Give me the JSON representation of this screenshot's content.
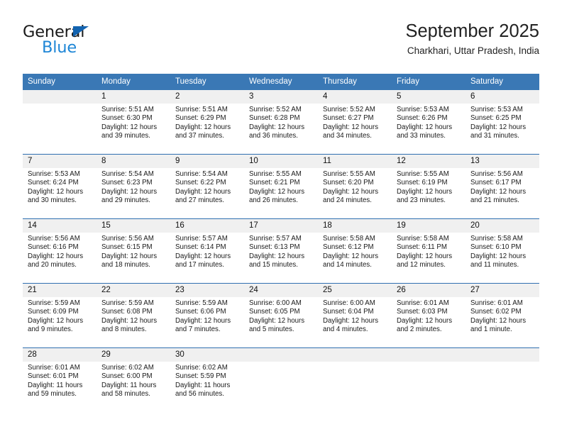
{
  "brand": {
    "word_one": "General",
    "word_two": "Blue",
    "logo_icon": "triangle-logo-icon",
    "accent_color": "#1e86d6",
    "logo_color": "#1263b0"
  },
  "header": {
    "title": "September 2025",
    "subtitle": "Charkhari, Uttar Pradesh, India",
    "header_bg_color": "#3a78b5"
  },
  "calendar": {
    "weekday_headers": [
      "Sunday",
      "Monday",
      "Tuesday",
      "Wednesday",
      "Thursday",
      "Friday",
      "Saturday"
    ],
    "weeks": [
      [
        {
          "day": "",
          "lines": []
        },
        {
          "day": "1",
          "lines": [
            "Sunrise: 5:51 AM",
            "Sunset: 6:30 PM",
            "Daylight: 12 hours",
            "and 39 minutes."
          ]
        },
        {
          "day": "2",
          "lines": [
            "Sunrise: 5:51 AM",
            "Sunset: 6:29 PM",
            "Daylight: 12 hours",
            "and 37 minutes."
          ]
        },
        {
          "day": "3",
          "lines": [
            "Sunrise: 5:52 AM",
            "Sunset: 6:28 PM",
            "Daylight: 12 hours",
            "and 36 minutes."
          ]
        },
        {
          "day": "4",
          "lines": [
            "Sunrise: 5:52 AM",
            "Sunset: 6:27 PM",
            "Daylight: 12 hours",
            "and 34 minutes."
          ]
        },
        {
          "day": "5",
          "lines": [
            "Sunrise: 5:53 AM",
            "Sunset: 6:26 PM",
            "Daylight: 12 hours",
            "and 33 minutes."
          ]
        },
        {
          "day": "6",
          "lines": [
            "Sunrise: 5:53 AM",
            "Sunset: 6:25 PM",
            "Daylight: 12 hours",
            "and 31 minutes."
          ]
        }
      ],
      [
        {
          "day": "7",
          "lines": [
            "Sunrise: 5:53 AM",
            "Sunset: 6:24 PM",
            "Daylight: 12 hours",
            "and 30 minutes."
          ]
        },
        {
          "day": "8",
          "lines": [
            "Sunrise: 5:54 AM",
            "Sunset: 6:23 PM",
            "Daylight: 12 hours",
            "and 29 minutes."
          ]
        },
        {
          "day": "9",
          "lines": [
            "Sunrise: 5:54 AM",
            "Sunset: 6:22 PM",
            "Daylight: 12 hours",
            "and 27 minutes."
          ]
        },
        {
          "day": "10",
          "lines": [
            "Sunrise: 5:55 AM",
            "Sunset: 6:21 PM",
            "Daylight: 12 hours",
            "and 26 minutes."
          ]
        },
        {
          "day": "11",
          "lines": [
            "Sunrise: 5:55 AM",
            "Sunset: 6:20 PM",
            "Daylight: 12 hours",
            "and 24 minutes."
          ]
        },
        {
          "day": "12",
          "lines": [
            "Sunrise: 5:55 AM",
            "Sunset: 6:19 PM",
            "Daylight: 12 hours",
            "and 23 minutes."
          ]
        },
        {
          "day": "13",
          "lines": [
            "Sunrise: 5:56 AM",
            "Sunset: 6:17 PM",
            "Daylight: 12 hours",
            "and 21 minutes."
          ]
        }
      ],
      [
        {
          "day": "14",
          "lines": [
            "Sunrise: 5:56 AM",
            "Sunset: 6:16 PM",
            "Daylight: 12 hours",
            "and 20 minutes."
          ]
        },
        {
          "day": "15",
          "lines": [
            "Sunrise: 5:56 AM",
            "Sunset: 6:15 PM",
            "Daylight: 12 hours",
            "and 18 minutes."
          ]
        },
        {
          "day": "16",
          "lines": [
            "Sunrise: 5:57 AM",
            "Sunset: 6:14 PM",
            "Daylight: 12 hours",
            "and 17 minutes."
          ]
        },
        {
          "day": "17",
          "lines": [
            "Sunrise: 5:57 AM",
            "Sunset: 6:13 PM",
            "Daylight: 12 hours",
            "and 15 minutes."
          ]
        },
        {
          "day": "18",
          "lines": [
            "Sunrise: 5:58 AM",
            "Sunset: 6:12 PM",
            "Daylight: 12 hours",
            "and 14 minutes."
          ]
        },
        {
          "day": "19",
          "lines": [
            "Sunrise: 5:58 AM",
            "Sunset: 6:11 PM",
            "Daylight: 12 hours",
            "and 12 minutes."
          ]
        },
        {
          "day": "20",
          "lines": [
            "Sunrise: 5:58 AM",
            "Sunset: 6:10 PM",
            "Daylight: 12 hours",
            "and 11 minutes."
          ]
        }
      ],
      [
        {
          "day": "21",
          "lines": [
            "Sunrise: 5:59 AM",
            "Sunset: 6:09 PM",
            "Daylight: 12 hours",
            "and 9 minutes."
          ]
        },
        {
          "day": "22",
          "lines": [
            "Sunrise: 5:59 AM",
            "Sunset: 6:08 PM",
            "Daylight: 12 hours",
            "and 8 minutes."
          ]
        },
        {
          "day": "23",
          "lines": [
            "Sunrise: 5:59 AM",
            "Sunset: 6:06 PM",
            "Daylight: 12 hours",
            "and 7 minutes."
          ]
        },
        {
          "day": "24",
          "lines": [
            "Sunrise: 6:00 AM",
            "Sunset: 6:05 PM",
            "Daylight: 12 hours",
            "and 5 minutes."
          ]
        },
        {
          "day": "25",
          "lines": [
            "Sunrise: 6:00 AM",
            "Sunset: 6:04 PM",
            "Daylight: 12 hours",
            "and 4 minutes."
          ]
        },
        {
          "day": "26",
          "lines": [
            "Sunrise: 6:01 AM",
            "Sunset: 6:03 PM",
            "Daylight: 12 hours",
            "and 2 minutes."
          ]
        },
        {
          "day": "27",
          "lines": [
            "Sunrise: 6:01 AM",
            "Sunset: 6:02 PM",
            "Daylight: 12 hours",
            "and 1 minute."
          ]
        }
      ],
      [
        {
          "day": "28",
          "lines": [
            "Sunrise: 6:01 AM",
            "Sunset: 6:01 PM",
            "Daylight: 11 hours",
            "and 59 minutes."
          ]
        },
        {
          "day": "29",
          "lines": [
            "Sunrise: 6:02 AM",
            "Sunset: 6:00 PM",
            "Daylight: 11 hours",
            "and 58 minutes."
          ]
        },
        {
          "day": "30",
          "lines": [
            "Sunrise: 6:02 AM",
            "Sunset: 5:59 PM",
            "Daylight: 11 hours",
            "and 56 minutes."
          ]
        },
        {
          "day": "",
          "lines": []
        },
        {
          "day": "",
          "lines": []
        },
        {
          "day": "",
          "lines": []
        },
        {
          "day": "",
          "lines": []
        }
      ]
    ]
  }
}
